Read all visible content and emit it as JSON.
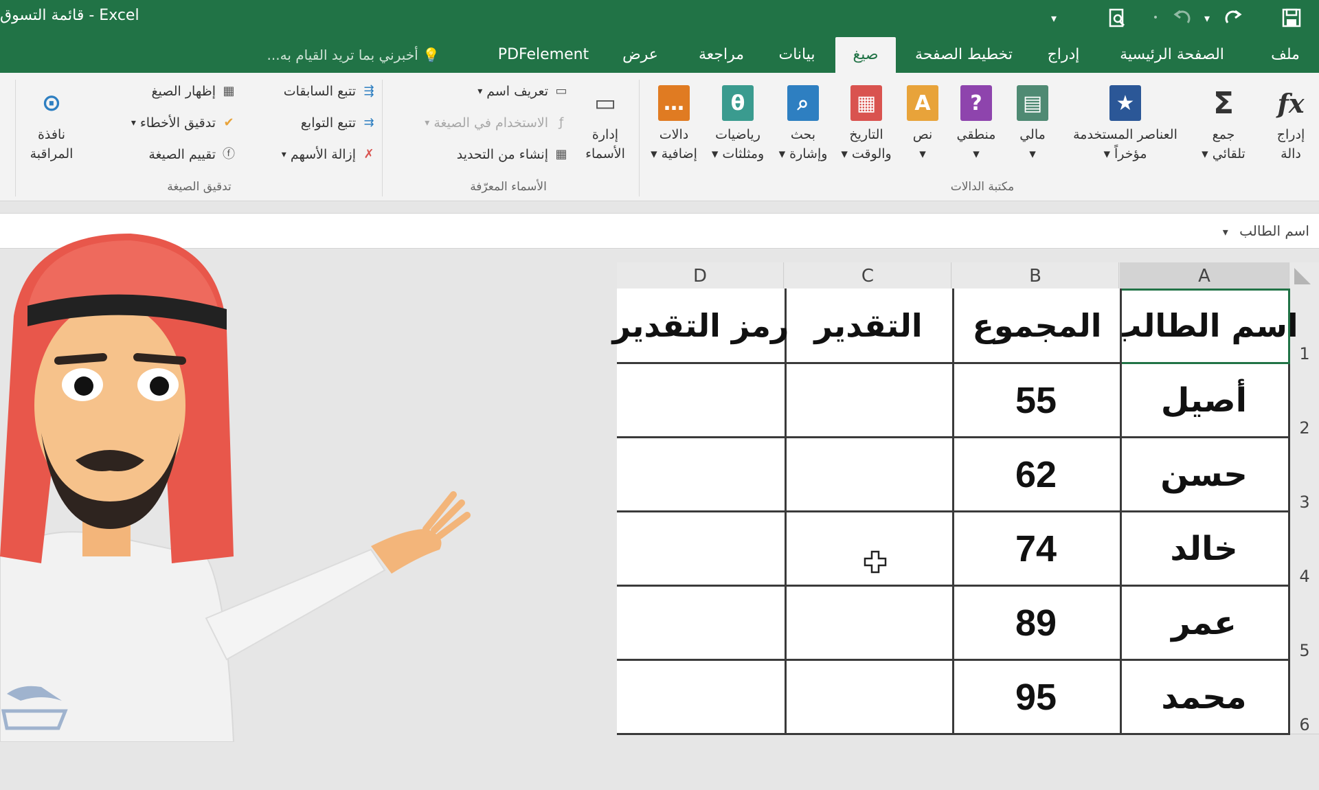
{
  "window": {
    "title": "Excel - قائمة التسوق",
    "qat_icons": [
      "save-icon",
      "redo-icon",
      "undo-dropdown-icon",
      "undo-icon",
      "print-preview-icon",
      "customize-qat-icon"
    ]
  },
  "tabs": [
    {
      "label": "ملف",
      "active": false
    },
    {
      "label": "الصفحة الرئيسية",
      "active": false
    },
    {
      "label": "إدراج",
      "active": false
    },
    {
      "label": "تخطيط الصفحة",
      "active": false
    },
    {
      "label": "صيغ",
      "active": true
    },
    {
      "label": "بيانات",
      "active": false
    },
    {
      "label": "مراجعة",
      "active": false
    },
    {
      "label": "عرض",
      "active": false
    },
    {
      "label": "PDFelement",
      "active": false
    }
  ],
  "tell_me": "أخبرني بما تريد القيام به...",
  "ribbon": {
    "function_library": {
      "label": "مكتبة الدالات",
      "buttons": [
        {
          "line1": "إدراج",
          "line2": "دالة",
          "icon": "fx-icon",
          "color": "#333333"
        },
        {
          "line1": "جمع",
          "line2": "تلقائي ▾",
          "icon": "sigma-icon",
          "color": "#333333"
        },
        {
          "line1": "العناصر المستخدمة",
          "line2": "مؤخراً ▾",
          "icon": "star-book-icon",
          "color": "#2b5797"
        },
        {
          "line1": "مالي",
          "line2": "▾",
          "icon": "finance-book-icon",
          "color": "#4f8a73"
        },
        {
          "line1": "منطقي",
          "line2": "▾",
          "icon": "logical-book-icon",
          "color": "#8e44ad"
        },
        {
          "line1": "نص",
          "line2": "▾",
          "icon": "text-book-icon",
          "color": "#e8a33a"
        },
        {
          "line1": "التاريخ",
          "line2": "والوقت ▾",
          "icon": "date-book-icon",
          "color": "#d9534f"
        },
        {
          "line1": "بحث",
          "line2": "وإشارة ▾",
          "icon": "lookup-book-icon",
          "color": "#2e7fc1"
        },
        {
          "line1": "رياضيات",
          "line2": "ومثلثات ▾",
          "icon": "math-book-icon",
          "color": "#3a9b8f"
        },
        {
          "line1": "دالات",
          "line2": "إضافية ▾",
          "icon": "more-functions-icon",
          "color": "#e07b22"
        }
      ]
    },
    "defined_names": {
      "label": "الأسماء المعرّفة",
      "name_manager": {
        "line1": "إدارة",
        "line2": "الأسماء"
      },
      "define_name": "تعريف اسم",
      "use_in_formula": "الاستخدام في الصيغة",
      "create_from_selection": "إنشاء من التحديد"
    },
    "formula_auditing": {
      "label": "تدقيق الصيغة",
      "trace_precedents": "تتبع السابقات",
      "trace_dependents": "تتبع التوابع",
      "remove_arrows": "إزالة الأسهم",
      "show_formulas": "إظهار الصيغ",
      "error_checking": "تدقيق الأخطاء",
      "evaluate_formula": "تقييم الصيغة",
      "watch_window": {
        "line1": "نافذة",
        "line2": "المراقبة"
      }
    }
  },
  "name_box": "اسم الطالب",
  "sheet": {
    "columns": [
      "A",
      "B",
      "C",
      "D"
    ],
    "selected_column": "A",
    "rows": [
      "1",
      "2",
      "3",
      "4",
      "5",
      "6"
    ],
    "headers": [
      "اسم الطالب",
      "المجموع",
      "التقدير",
      "رمز التقدير"
    ],
    "data": [
      [
        "أصيل",
        "55",
        "",
        ""
      ],
      [
        "حسن",
        "62",
        "",
        ""
      ],
      [
        "خالد",
        "74",
        "",
        ""
      ],
      [
        "عمر",
        "89",
        "",
        ""
      ],
      [
        "محمد",
        "95",
        "",
        ""
      ]
    ]
  },
  "colors": {
    "excel_green": "#217346",
    "ribbon_bg": "#f3f3f3"
  }
}
